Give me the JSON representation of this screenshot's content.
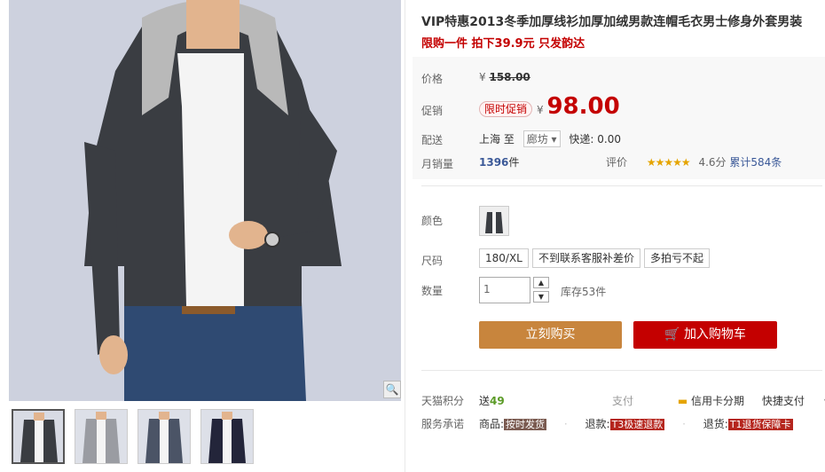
{
  "product": {
    "title": "VIP特惠2013冬季加厚线衫加厚加绒男款连帽毛衣男士修身外套男装",
    "subtitle": "限购一件 拍下39.9元 只发韵达"
  },
  "price": {
    "label": "价格",
    "currency": "¥",
    "original": "158.00"
  },
  "promo": {
    "label": "促销",
    "badge": "限时促销",
    "currency": "¥",
    "price": "98.00"
  },
  "shipping": {
    "label": "配送",
    "from": "上海",
    "to_word": "至",
    "destination": "廊坊",
    "express": "快递: 0.00"
  },
  "sales": {
    "label": "月销量",
    "count": "1396",
    "unit": "件",
    "rating_label": "评价",
    "stars": "★★★★★",
    "score": "4.6分",
    "total": "累计584条"
  },
  "color": {
    "label": "颜色"
  },
  "size": {
    "label": "尺码",
    "options": [
      "180/XL",
      "不到联系客服补差价",
      "多拍亏不起"
    ]
  },
  "quantity": {
    "label": "数量",
    "value": "1",
    "stock": "库存53件"
  },
  "actions": {
    "buy": "立刻购买",
    "cart": "加入购物车"
  },
  "tmall_points": {
    "label": "天猫积分",
    "prefix": "送",
    "value": "49"
  },
  "payment": {
    "label": "支付",
    "credit": "信用卡分期",
    "quick": "快捷支付"
  },
  "service": {
    "label": "服务承诺",
    "goods": "商品:",
    "goods_tag": "按时发货",
    "refund": "退款:",
    "refund_tag": "T3极速退款",
    "return": "退货:",
    "return_tag": "T1退货保障卡"
  },
  "colors": {
    "accent_red": "#c40000",
    "buy_orange": "#c8853d"
  }
}
